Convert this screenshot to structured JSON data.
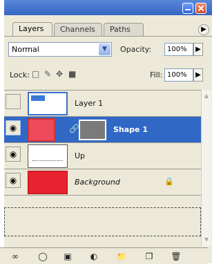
{
  "window": {
    "minimize_icon": "minimize-icon",
    "close_icon": "close-icon"
  },
  "tabs": [
    {
      "label": "Layers",
      "active": true
    },
    {
      "label": "Channels",
      "active": false
    },
    {
      "label": "Paths",
      "active": false
    }
  ],
  "blend_mode": {
    "value": "Normal"
  },
  "opacity": {
    "label": "Opacity:",
    "value": "100%"
  },
  "lock": {
    "label": "Lock:"
  },
  "fill": {
    "label": "Fill:",
    "value": "100%"
  },
  "layers": [
    {
      "name": "Layer 1",
      "visible": false,
      "selected": false,
      "thumb_color": "#ffffff"
    },
    {
      "name": "Shape 1",
      "visible": true,
      "selected": true,
      "thumb_color": "#ee4a5b",
      "mask_color": "#7a7a7a"
    },
    {
      "name": "Up",
      "visible": true,
      "selected": false,
      "thumb_color": "#ffffff"
    },
    {
      "name": "Background",
      "visible": true,
      "selected": false,
      "thumb_color": "#e8222f",
      "locked": true
    }
  ],
  "colors": {
    "selection": "#3168c6",
    "panel_bg": "#ece9d8",
    "titlebar": "#3566c4"
  }
}
